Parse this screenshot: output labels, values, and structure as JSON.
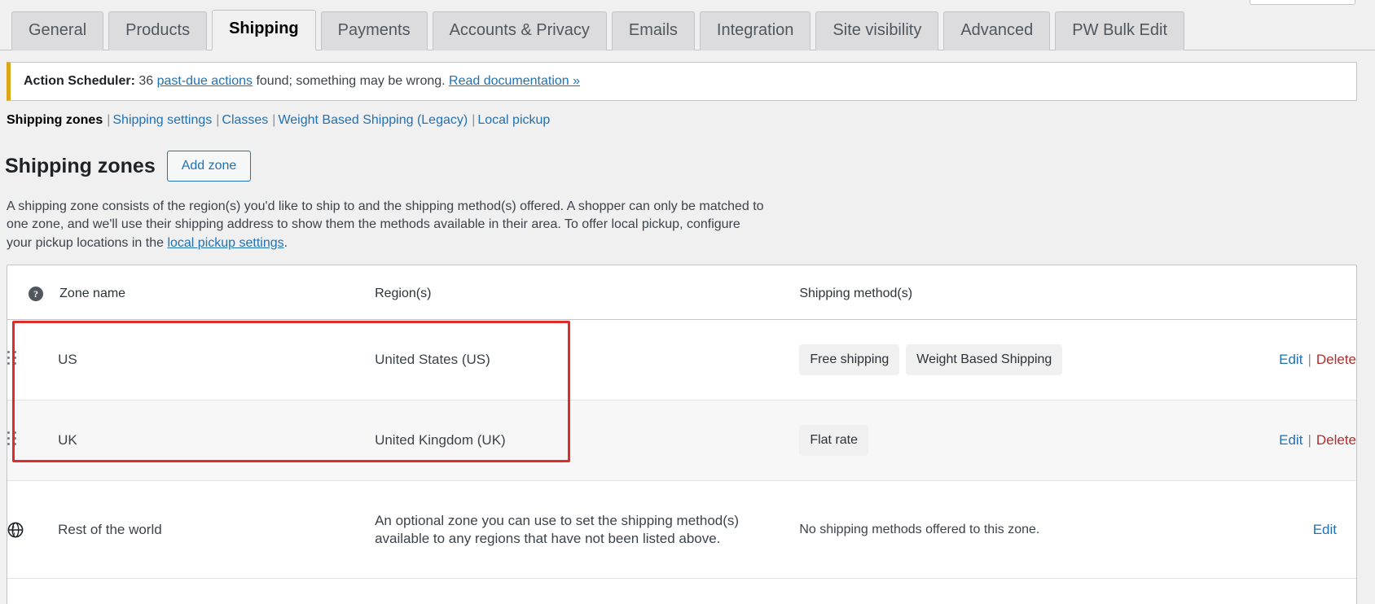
{
  "tabs": [
    {
      "label": "General",
      "active": false
    },
    {
      "label": "Products",
      "active": false
    },
    {
      "label": "Shipping",
      "active": true
    },
    {
      "label": "Payments",
      "active": false
    },
    {
      "label": "Accounts & Privacy",
      "active": false
    },
    {
      "label": "Emails",
      "active": false
    },
    {
      "label": "Integration",
      "active": false
    },
    {
      "label": "Site visibility",
      "active": false
    },
    {
      "label": "Advanced",
      "active": false
    },
    {
      "label": "PW Bulk Edit",
      "active": false
    }
  ],
  "notice": {
    "label": "Action Scheduler:",
    "count_text": " 36 ",
    "link_text": "past-due actions",
    "middle_text": " found; something may be wrong. ",
    "doc_link_text": "Read documentation »",
    "accent_color": "#dba617"
  },
  "subnav": {
    "current": "Shipping zones",
    "items": [
      "Shipping settings",
      "Classes",
      "Weight Based Shipping (Legacy)",
      "Local pickup"
    ]
  },
  "page": {
    "title": "Shipping zones",
    "add_zone_label": "Add zone",
    "description_part1": "A shipping zone consists of the region(s) you'd like to ship to and the shipping method(s) offered. A shopper can only be matched to one zone, and we'll use their shipping address to show them the methods available in their area. To offer local pickup, configure your pickup locations in the ",
    "description_link": "local pickup settings",
    "description_part2": "."
  },
  "table": {
    "columns": {
      "help": "?",
      "zone_name": "Zone name",
      "regions": "Region(s)",
      "methods": "Shipping method(s)",
      "actions": ""
    },
    "rows": [
      {
        "sort_icon": "drag-handle-icon",
        "name": "US",
        "region": "United States (US)",
        "methods": [
          "Free shipping",
          "Weight Based Shipping"
        ],
        "edit_label": "Edit",
        "separator": "|",
        "delete_label": "Delete"
      },
      {
        "sort_icon": "drag-handle-icon",
        "name": "UK",
        "region": "United Kingdom (UK)",
        "methods": [
          "Flat rate"
        ],
        "edit_label": "Edit",
        "separator": "|",
        "delete_label": "Delete"
      }
    ],
    "worldwide_row": {
      "icon": "globe-icon",
      "name": "Rest of the world",
      "region": "An optional zone you can use to set the shipping method(s) available to any regions that have not been listed above.",
      "methods_text": "No shipping methods offered to this zone.",
      "edit_label": "Edit"
    }
  },
  "annotation": {
    "color": "#e02b2b",
    "description": "red rectangle highlighting the US and UK shipping zone rows"
  }
}
